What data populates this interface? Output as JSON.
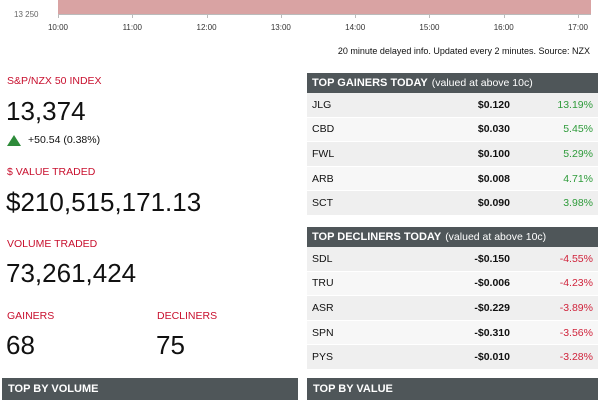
{
  "chart": {
    "y_label": "13 250",
    "ticks": [
      "10:00",
      "11:00",
      "12:00",
      "13:00",
      "14:00",
      "15:00",
      "16:00",
      "17:00"
    ],
    "fill_color": "#d9a3a3"
  },
  "delay_note": "20 minute delayed info. Updated every 2 minutes. Source: NZX",
  "index": {
    "label": "S&P/NZX 50 INDEX",
    "value": "13,374",
    "change": "+50.54 (0.38%)",
    "trend_icon": "triangle-up-icon"
  },
  "value_traded": {
    "label": "$ VALUE TRADED",
    "value": "$210,515,171.13"
  },
  "volume_traded": {
    "label": "VOLUME TRADED",
    "value": "73,261,424"
  },
  "gainers": {
    "label": "GAINERS",
    "value": "68"
  },
  "decliners": {
    "label": "DECLINERS",
    "value": "75"
  },
  "top_gainers": {
    "title": "TOP GAINERS TODAY",
    "subtitle": "(valued at above 10c)",
    "rows": [
      {
        "code": "JLG",
        "price": "$0.120",
        "pct": "13.19%"
      },
      {
        "code": "CBD",
        "price": "$0.030",
        "pct": "5.45%"
      },
      {
        "code": "FWL",
        "price": "$0.100",
        "pct": "5.29%"
      },
      {
        "code": "ARB",
        "price": "$0.008",
        "pct": "4.71%"
      },
      {
        "code": "SCT",
        "price": "$0.090",
        "pct": "3.98%"
      }
    ]
  },
  "top_decliners": {
    "title": "TOP DECLINERS TODAY",
    "subtitle": "(valued at above 10c)",
    "rows": [
      {
        "code": "SDL",
        "price": "-$0.150",
        "pct": "-4.55%"
      },
      {
        "code": "TRU",
        "price": "-$0.006",
        "pct": "-4.23%"
      },
      {
        "code": "ASR",
        "price": "-$0.229",
        "pct": "-3.89%"
      },
      {
        "code": "SPN",
        "price": "-$0.310",
        "pct": "-3.56%"
      },
      {
        "code": "PYS",
        "price": "-$0.010",
        "pct": "-3.28%"
      }
    ]
  },
  "top_by_volume": {
    "title": "TOP BY VOLUME"
  },
  "top_by_value": {
    "title": "TOP BY VALUE"
  },
  "colors": {
    "label_red": "#c8102e",
    "positive": "#2e9b3a",
    "negative": "#d0243c",
    "header_bg": "#4f5659"
  }
}
